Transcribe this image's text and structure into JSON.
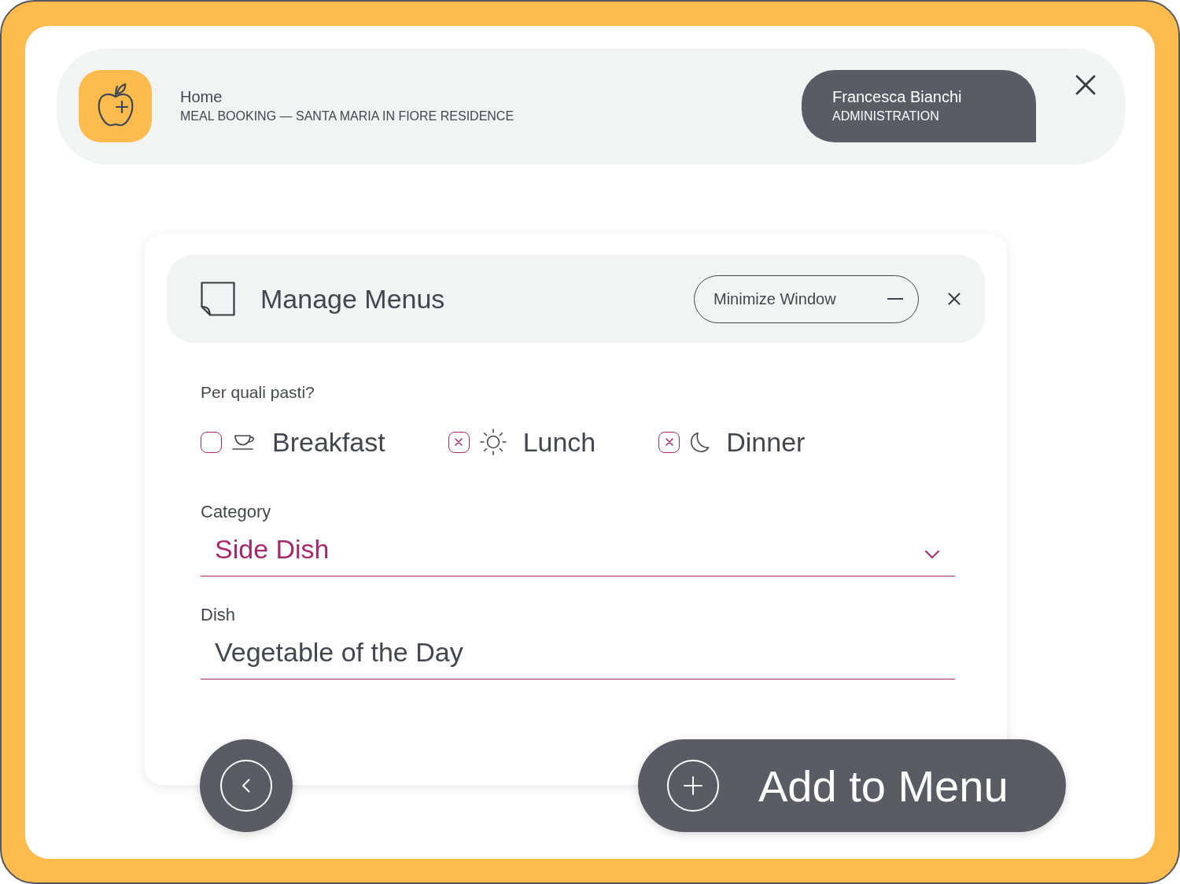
{
  "header": {
    "title": "Home",
    "subtitle": "MEAL BOOKING — SANTA MARIA IN FIORE RESIDENCE",
    "user": {
      "name": "Francesca Bianchi",
      "role": "ADMINISTRATION"
    }
  },
  "dialog": {
    "title": "Manage Menus",
    "minimize_button": "Minimize Window",
    "meals_label": "Per quali pasti?",
    "meals": [
      {
        "label": "Breakfast",
        "checked": false
      },
      {
        "label": "Lunch",
        "checked": true
      },
      {
        "label": "Dinner",
        "checked": true
      }
    ],
    "category": {
      "label": "Category",
      "value": "Side Dish"
    },
    "dish": {
      "label": "Dish",
      "value": "Vegetable of the Day"
    }
  },
  "actions": {
    "add_button": "Add to Menu"
  }
}
